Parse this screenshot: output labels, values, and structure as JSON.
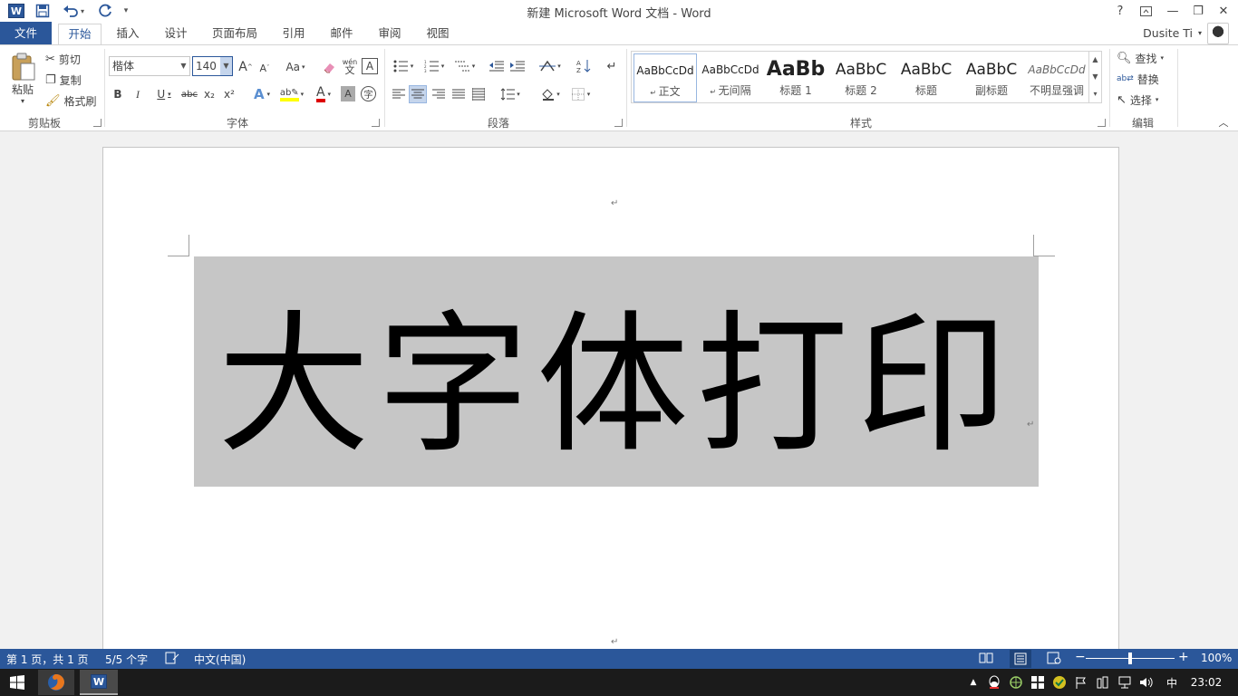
{
  "window": {
    "title": "新建 Microsoft Word 文档 - Word",
    "help": "?",
    "minimize": "—",
    "restore": "❐",
    "close": "✕"
  },
  "quick_access": {
    "logo": "W",
    "save_icon": "save-icon",
    "undo_icon": "undo-icon",
    "redo_icon": "redo-icon",
    "customize": "▾"
  },
  "tabs": [
    {
      "label": "文件"
    },
    {
      "label": "开始"
    },
    {
      "label": "插入"
    },
    {
      "label": "设计"
    },
    {
      "label": "页面布局"
    },
    {
      "label": "引用"
    },
    {
      "label": "邮件"
    },
    {
      "label": "审阅"
    },
    {
      "label": "视图"
    }
  ],
  "user": {
    "name": "Dusite Ti"
  },
  "clipboard": {
    "paste": "粘贴",
    "cut": "剪切",
    "copy": "复制",
    "format_painter": "格式刷",
    "label": "剪贴板"
  },
  "font": {
    "name": "楷体",
    "size": "140",
    "grow": "A",
    "shrink": "A",
    "change_case": "Aa",
    "bold": "B",
    "italic": "I",
    "underline": "U",
    "strike": "abc",
    "subscript": "x₂",
    "superscript": "x²",
    "phonetic": "wén",
    "label": "字体"
  },
  "paragraph": {
    "label": "段落"
  },
  "styles": {
    "label": "样式",
    "items": [
      {
        "preview": "AaBbCcDd",
        "name": "正文"
      },
      {
        "preview": "AaBbCcDd",
        "name": "无间隔"
      },
      {
        "preview": "AaBb",
        "name": "标题 1"
      },
      {
        "preview": "AaBbC",
        "name": "标题 2"
      },
      {
        "preview": "AaBbC",
        "name": "标题"
      },
      {
        "preview": "AaBbC",
        "name": "副标题"
      },
      {
        "preview": "AaBbCcDd",
        "name": "不明显强调"
      }
    ]
  },
  "editing": {
    "find": "查找",
    "replace": "替换",
    "select": "选择",
    "label": "编辑"
  },
  "document": {
    "text": "大字体打印",
    "para_mark": "↵"
  },
  "status": {
    "page": "第 1 页，共 1 页",
    "words": "5/5 个字",
    "language": "中文(中国)",
    "zoom": "100%",
    "zoom_fraction": 0.5
  },
  "taskbar": {
    "clock": "23:02",
    "ime": "中"
  }
}
